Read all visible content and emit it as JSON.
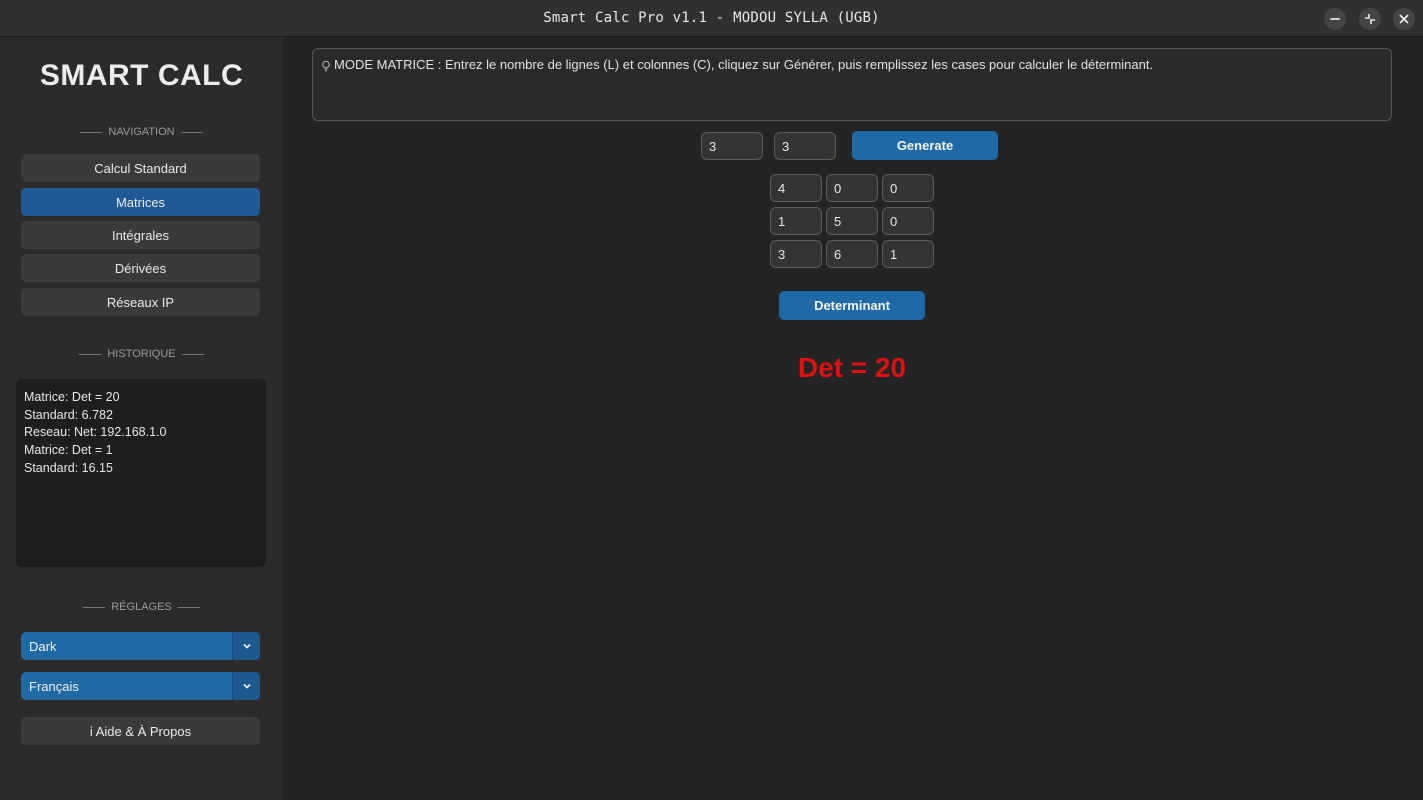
{
  "window": {
    "title": "Smart Calc Pro v1.1 - MODOU SYLLA (UGB)"
  },
  "sidebar": {
    "logo": "SMART CALC",
    "navigation_label": "NAVIGATION",
    "nav_items": [
      {
        "label": "Calcul Standard",
        "active": false
      },
      {
        "label": "Matrices",
        "active": true
      },
      {
        "label": "Intégrales",
        "active": false
      },
      {
        "label": "Dérivées",
        "active": false
      },
      {
        "label": "Réseaux IP",
        "active": false
      }
    ],
    "history_label": "HISTORIQUE",
    "history": [
      "Matrice: Det = 20",
      "Standard: 6.782",
      "Reseau: Net: 192.168.1.0",
      "Matrice: Det = 1",
      "Standard: 16.15"
    ],
    "settings_label": "RÉGLAGES",
    "theme_select": "Dark",
    "language_select": "Français",
    "help_button": "i Aide & À Propos"
  },
  "main": {
    "info_text": "MODE MATRICE : Entrez le nombre de lignes (L) et colonnes (C), cliquez sur Générer, puis remplissez les cases pour calculer le déterminant.",
    "rows_value": "3",
    "cols_value": "3",
    "generate_button": "Generate",
    "matrix": [
      [
        "4",
        "0",
        "0"
      ],
      [
        "1",
        "5",
        "0"
      ],
      [
        "3",
        "6",
        "1"
      ]
    ],
    "determinant_button": "Determinant",
    "result": "Det = 20"
  },
  "colors": {
    "accent": "#1f6aa5",
    "active_nav": "#1f5a96",
    "result": "#e01010",
    "background": "#242424",
    "sidebar": "#2b2b2b"
  },
  "icons": {
    "info": "lightbulb-icon",
    "minimize": "minimize-icon",
    "restore": "restore-icon",
    "close": "close-icon",
    "dropdown": "chevron-down-icon"
  }
}
